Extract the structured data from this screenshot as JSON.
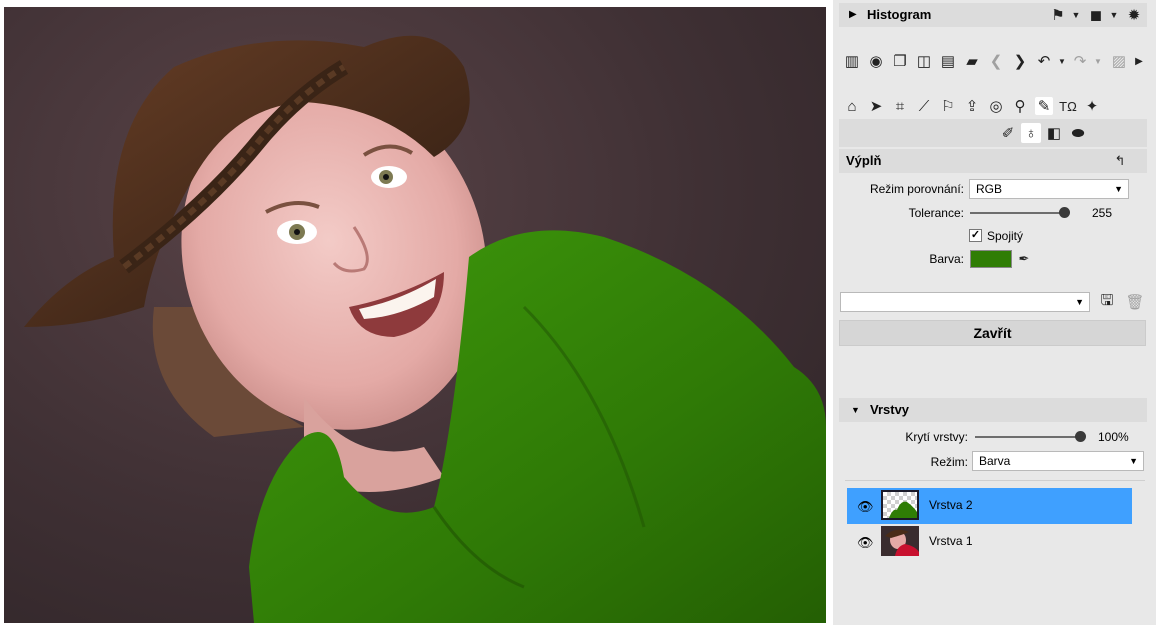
{
  "colors": {
    "fill_swatch": "#2f7d05",
    "selection": "#3fa0ff",
    "panel": "#e8e8e8"
  },
  "histogram": {
    "title": "Histogram",
    "icons": [
      "flag-icon",
      "dropdown-icon",
      "square-icon",
      "dropdown-icon",
      "gear-icon"
    ]
  },
  "toolbar": {
    "icons": [
      "histogram-icon",
      "develop-icon",
      "copy-icon",
      "compare-icon",
      "calendar-icon",
      "folder-icon",
      "back-icon",
      "forward-icon",
      "undo-icon",
      "redo-icon",
      "image-icon",
      "more-icon"
    ]
  },
  "tools": {
    "icons": [
      "home-icon",
      "pointer-icon",
      "crop-icon",
      "straighten-icon",
      "perspective-icon",
      "export-icon",
      "redeye-icon",
      "clone-icon",
      "brush-tool-icon",
      "text-icon",
      "effects-icon"
    ],
    "sub_icons": [
      "brush-icon",
      "fill-bucket-icon",
      "gradient-icon",
      "eraser-icon"
    ]
  },
  "fill_panel": {
    "title": "Výplň",
    "compare_mode_label": "Režim porovnání:",
    "compare_mode_value": "RGB",
    "tolerance_label": "Tolerance:",
    "tolerance_value": "255",
    "contiguous_label": "Spojitý",
    "contiguous_checked": true,
    "color_label": "Barva:",
    "preset_value": "",
    "close_label": "Zavřít"
  },
  "layers_panel": {
    "title": "Vrstvy",
    "opacity_label": "Krytí vrstvy:",
    "opacity_value": "100%",
    "mode_label": "Režim:",
    "mode_value": "Barva",
    "layers": [
      {
        "name": "Vrstva 2",
        "selected": true
      },
      {
        "name": "Vrstva 1",
        "selected": false
      }
    ]
  }
}
